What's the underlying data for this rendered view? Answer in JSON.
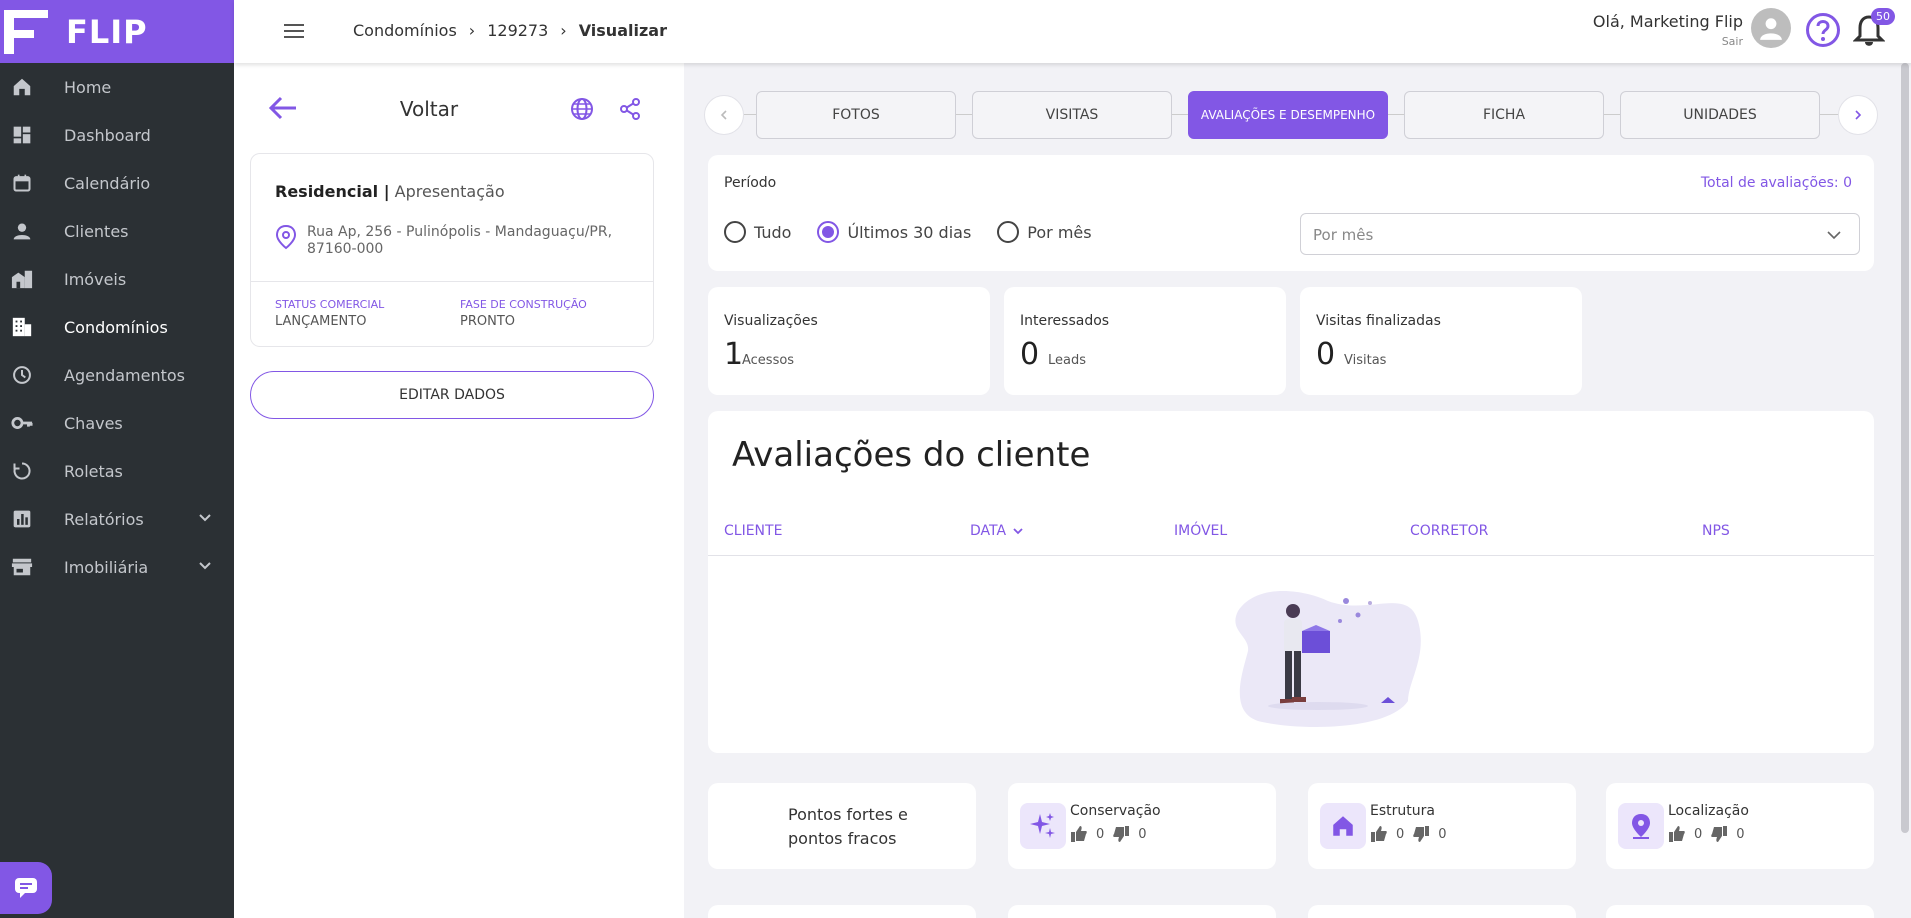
{
  "brand": {
    "name": "FLIP",
    "accent": "#8257e5",
    "sidebar_bg": "#2b3034"
  },
  "sidebar": {
    "items": [
      {
        "label": "Home",
        "icon": "home-icon"
      },
      {
        "label": "Dashboard",
        "icon": "dashboard-icon"
      },
      {
        "label": "Calendário",
        "icon": "calendar-icon"
      },
      {
        "label": "Clientes",
        "icon": "person-icon"
      },
      {
        "label": "Imóveis",
        "icon": "building-icon"
      },
      {
        "label": "Condomínios",
        "icon": "apartment-icon",
        "active": true
      },
      {
        "label": "Agendamentos",
        "icon": "clock-icon"
      },
      {
        "label": "Chaves",
        "icon": "key-icon"
      },
      {
        "label": "Roletas",
        "icon": "rotate-icon"
      },
      {
        "label": "Relatórios",
        "icon": "report-icon",
        "expandable": true
      },
      {
        "label": "Imobiliária",
        "icon": "store-icon",
        "expandable": true
      }
    ]
  },
  "topbar": {
    "breadcrumb": [
      "Condomínios",
      "129273",
      "Visualizar"
    ],
    "greeting": "Olá, Marketing Flip",
    "logout": "Sair",
    "notifications": "50"
  },
  "panel": {
    "back_label": "Voltar",
    "type": "Residencial |",
    "subtitle": "Apresentação",
    "address": "Rua Ap, 256 - Pulinópolis - Mandaguaçu/PR, 87160-000",
    "status_label": "STATUS COMERCIAL",
    "status_value": "LANÇAMENTO",
    "phase_label": "FASE DE CONSTRUÇÃO",
    "phase_value": "PRONTO",
    "edit_label": "EDITAR DADOS"
  },
  "tabs": [
    {
      "label": "FOTOS"
    },
    {
      "label": "VISITAS"
    },
    {
      "label": "AVALIAÇÕES E DESEMPENHO",
      "active": true
    },
    {
      "label": "FICHA"
    },
    {
      "label": "UNIDADES"
    }
  ],
  "period": {
    "label": "Período",
    "total": "Total de avaliações: 0",
    "options": [
      "Tudo",
      "Últimos 30 dias",
      "Por mês"
    ],
    "selected": "Últimos 30 dias",
    "select_placeholder": "Por mês"
  },
  "stats": [
    {
      "title": "Visualizações",
      "value": "1",
      "unit": "Acessos"
    },
    {
      "title": "Interessados",
      "value": "0",
      "unit": "Leads"
    },
    {
      "title": "Visitas finalizadas",
      "value": "0",
      "unit": "Visitas"
    }
  ],
  "reviews": {
    "title": "Avaliações do cliente",
    "columns": [
      "CLIENTE",
      "DATA",
      "IMÓVEL",
      "CORRETOR",
      "NPS"
    ]
  },
  "strengths": {
    "title_line1": "Pontos fortes e",
    "title_line2": "pontos fracos",
    "criteria": [
      {
        "name": "Conservação",
        "icon": "sparkle-icon",
        "up": "0",
        "down": "0"
      },
      {
        "name": "Estrutura",
        "icon": "house-icon",
        "up": "0",
        "down": "0"
      },
      {
        "name": "Localização",
        "icon": "location-pin-icon",
        "up": "0",
        "down": "0"
      }
    ]
  }
}
